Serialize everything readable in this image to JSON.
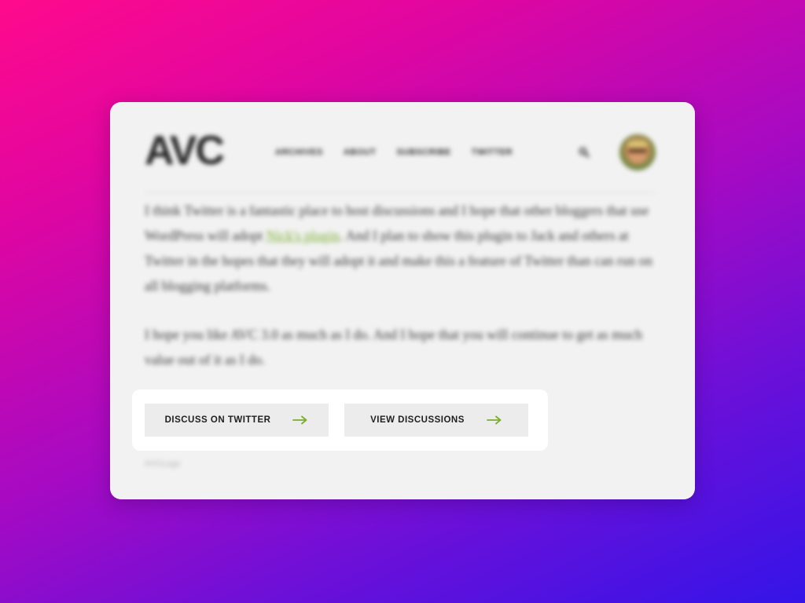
{
  "header": {
    "logo": "AVC",
    "nav": [
      "ARCHIVES",
      "ABOUT",
      "SUBSCRIBE",
      "TWITTER"
    ],
    "search_icon": "search-icon",
    "avatar_icon": "avatar"
  },
  "article": {
    "p1_before": "I think Twitter is a fantastic place to host discussions and I hope that other bloggers that use WordPress will adopt ",
    "p1_link": "Nick's plugin",
    "p1_after": ". And I plan to show this plugin to Jack and others at Twitter in the hopes that they will adopt it and make this a feature of Twitter than can run on all blogging platforms.",
    "p2": "I hope you like AVC 3.0 as much as I do. And I hope that you will continue to get as much value out of it as I do."
  },
  "actions": {
    "discuss_label": "DISCUSS ON TWITTER",
    "view_label": "VIEW DISCUSSIONS",
    "arrow_icon": "arrow-right-icon"
  },
  "tags": "#VCLogs",
  "colors": {
    "accent": "#7aae2f",
    "card_bg": "#f2f2f2",
    "button_bg": "#ececec",
    "gradient_start": "#ff0a8c",
    "gradient_end": "#3414e8"
  }
}
